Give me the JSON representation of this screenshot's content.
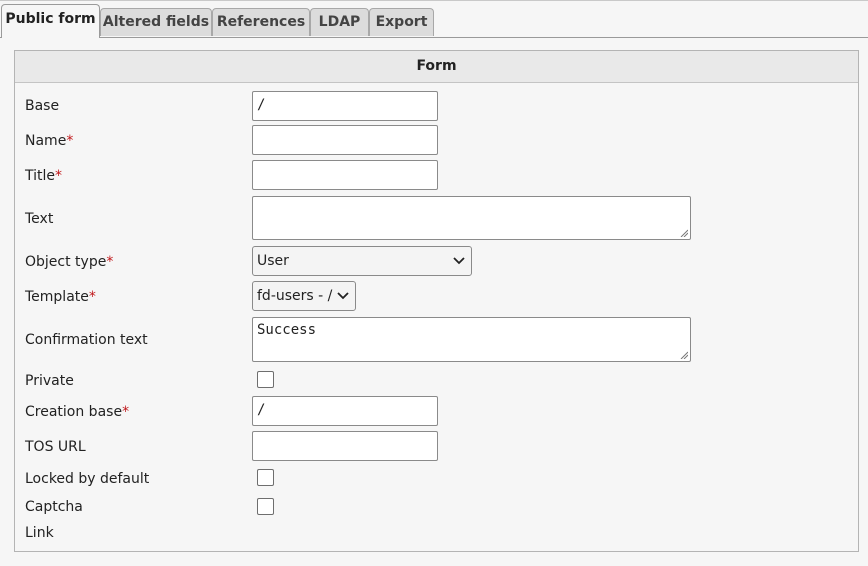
{
  "tabs": [
    {
      "label": "Public form",
      "active": true
    },
    {
      "label": "Altered fields",
      "active": false
    },
    {
      "label": "References",
      "active": false
    },
    {
      "label": "LDAP",
      "active": false
    },
    {
      "label": "Export",
      "active": false
    }
  ],
  "panel": {
    "title": "Form"
  },
  "fields": {
    "base": {
      "label": "Base",
      "value": "/"
    },
    "name": {
      "label": "Name",
      "required_mark": "*",
      "value": ""
    },
    "title": {
      "label": "Title",
      "required_mark": "*",
      "value": ""
    },
    "text": {
      "label": "Text",
      "value": ""
    },
    "object_type": {
      "label": "Object type",
      "required_mark": "*",
      "selected": "User"
    },
    "template": {
      "label": "Template",
      "required_mark": "*",
      "selected": "fd-users - /"
    },
    "confirmation_text": {
      "label": "Confirmation text",
      "value": "Success"
    },
    "private": {
      "label": "Private",
      "checked": false
    },
    "creation_base": {
      "label": "Creation base",
      "required_mark": "*",
      "value": "/"
    },
    "tos_url": {
      "label": "TOS URL",
      "value": ""
    },
    "locked_by_default": {
      "label": "Locked by default",
      "checked": false
    },
    "captcha": {
      "label": "Captcha",
      "checked": false
    },
    "link": {
      "label": "Link"
    }
  },
  "colors": {
    "required": "#c0171a",
    "tab_inactive": "#dcdcdc",
    "panel_header": "#e9e9e9"
  }
}
